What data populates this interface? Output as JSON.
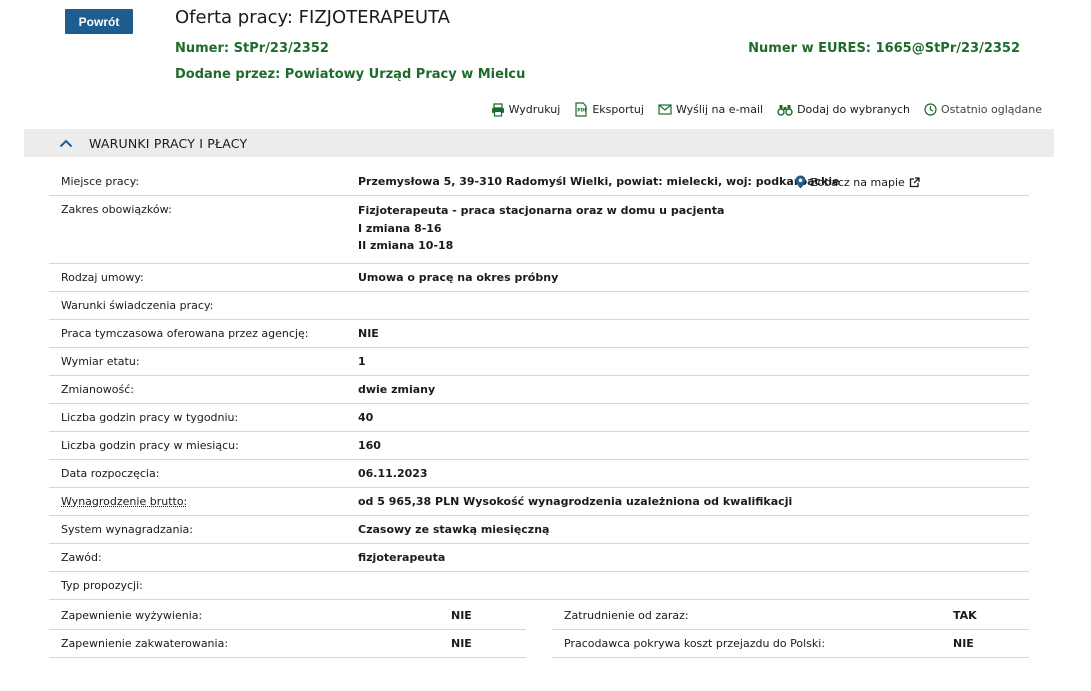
{
  "header": {
    "back_label": "Powrót",
    "title": "Oferta pracy: FIZJOTERAPEUTA",
    "number_label": "Numer:",
    "number_value": "StPr/23/2352",
    "eures_label": "Numer w EURES:",
    "eures_value": "1665@StPr/23/2352",
    "added_label": "Dodane przez:",
    "added_value": "Powiatowy Urząd Pracy w Mielcu"
  },
  "actions": [
    {
      "label": "Wydrukuj",
      "icon": "printer-icon"
    },
    {
      "label": "Eksportuj",
      "icon": "pdf-export-icon"
    },
    {
      "label": "Wyślij na e-mail",
      "icon": "envelope-icon"
    },
    {
      "label": "Dodaj do wybranych",
      "icon": "binoculars-icon"
    },
    {
      "label": "Ostatnio oglądane",
      "icon": "clock-icon"
    }
  ],
  "section": {
    "title": "WARUNKI PRACY I PŁACY"
  },
  "rows": [
    {
      "label": "Miejsce pracy:",
      "value": "Przemysłowa 5, 39-310 Radomyśl Wielki, powiat: mielecki, woj: podkarpackie"
    },
    {
      "label": "Zakres obowiązków:",
      "lines": [
        "Fizjoterapeuta - praca stacjonarna oraz w domu u pacjenta",
        "I zmiana 8-16",
        "II zmiana 10-18"
      ]
    },
    {
      "label": "Rodzaj umowy:",
      "value": "Umowa o pracę na okres próbny"
    },
    {
      "label": "Warunki świadczenia pracy:",
      "value": ""
    },
    {
      "label": "Praca tymczasowa oferowana przez agencję:",
      "value": "NIE"
    },
    {
      "label": "Wymiar etatu:",
      "value": "1"
    },
    {
      "label": "Zmianowość:",
      "value": "dwie zmiany"
    },
    {
      "label": "Liczba godzin pracy w tygodniu:",
      "value": "40"
    },
    {
      "label": "Liczba godzin pracy w miesiącu:",
      "value": "160"
    },
    {
      "label": "Data rozpoczęcia:",
      "value": "06.11.2023"
    },
    {
      "label": "Wynagrodzenie brutto:",
      "value": "od 5 965,38 PLN Wysokość wynagrodzenia uzależniona od kwalifikacji"
    },
    {
      "label": "System wynagradzania:",
      "value": "Czasowy ze stawką miesięczną"
    },
    {
      "label": "Zawód:",
      "value": "fizjoterapeuta"
    },
    {
      "label": "Typ propozycji:",
      "value": ""
    }
  ],
  "map_link": "Zobacz na mapie",
  "pairs": [
    {
      "left_label": "Zapewnienie wyżywienia:",
      "left_value": "NIE",
      "right_label": "Zatrudnienie od zaraz:",
      "right_value": "TAK"
    },
    {
      "left_label": "Zapewnienie zakwaterowania:",
      "left_value": "NIE",
      "right_label": "Pracodawca pokrywa koszt przejazdu do Polski:",
      "right_value": "NIE"
    }
  ],
  "colors": {
    "accent_blue": "#1f5d91",
    "accent_green": "#1e6b2c",
    "section_bg": "#ececec"
  }
}
